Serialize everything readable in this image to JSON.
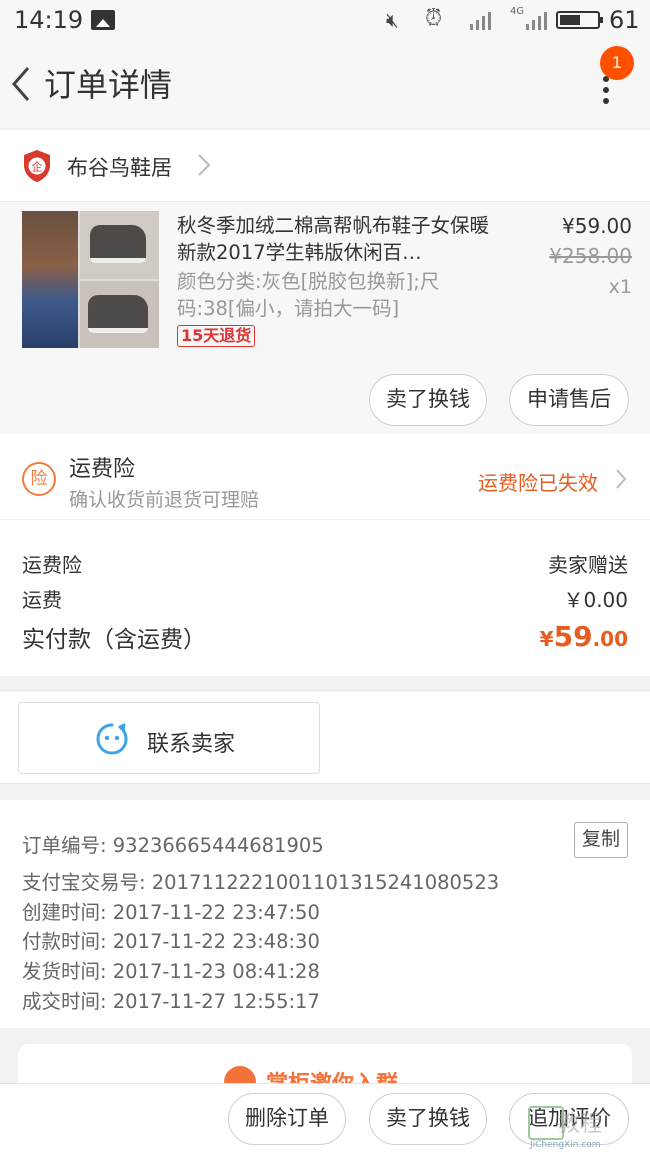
{
  "status_bar": {
    "time": "14:19",
    "network": "4G",
    "battery": "61"
  },
  "nav": {
    "title": "订单详情",
    "badge_count": "1"
  },
  "store": {
    "name": "布谷鸟鞋居",
    "icon_label": "企"
  },
  "product": {
    "title": "秋冬季加绒二棉高帮帆布鞋子女保暖新款2017学生韩版休闲百…",
    "spec": "颜色分类:灰色[脱胶包换新];尺码:38[偏小，请拍大一码]",
    "return_badge": "15天退货",
    "price": "¥59.00",
    "original_price": "¥258.00",
    "quantity": "x1"
  },
  "actions": {
    "sell_label": "卖了换钱",
    "aftersale_label": "申请售后"
  },
  "insurance": {
    "icon_label": "险",
    "title": "运费险",
    "subtitle": "确认收货前退货可理赔",
    "status": "运费险已失效"
  },
  "fees": [
    {
      "label": "运费险",
      "value": "卖家赠送"
    },
    {
      "label": "运费",
      "value": "￥0.00"
    }
  ],
  "total": {
    "label": "实付款（含运费）",
    "currency": "¥",
    "integer": "59",
    "decimal": ".00"
  },
  "contact": {
    "label": "联系卖家"
  },
  "order_info": {
    "copy_label": "复制",
    "lines": [
      "订单编号: 93236665444681905",
      "支付宝交易号: 2017112221001101315241080523",
      "创建时间: 2017-11-22 23:47:50",
      "付款时间: 2017-11-22 23:48:30",
      "发货时间: 2017-11-23 08:41:28",
      "成交时间: 2017-11-27 12:55:17"
    ]
  },
  "promo": {
    "text": "掌柜邀你入群"
  },
  "bottom_bar": {
    "delete_label": "删除订单",
    "sell_label": "卖了换钱",
    "review_label": "追加评价"
  },
  "watermark": {
    "text": "教程",
    "url": "JiChengXin.com"
  },
  "colors": {
    "accent": "#e85c1f",
    "badge": "#ff5000",
    "brand_red": "#d33",
    "chat_blue": "#3aa6e8"
  }
}
